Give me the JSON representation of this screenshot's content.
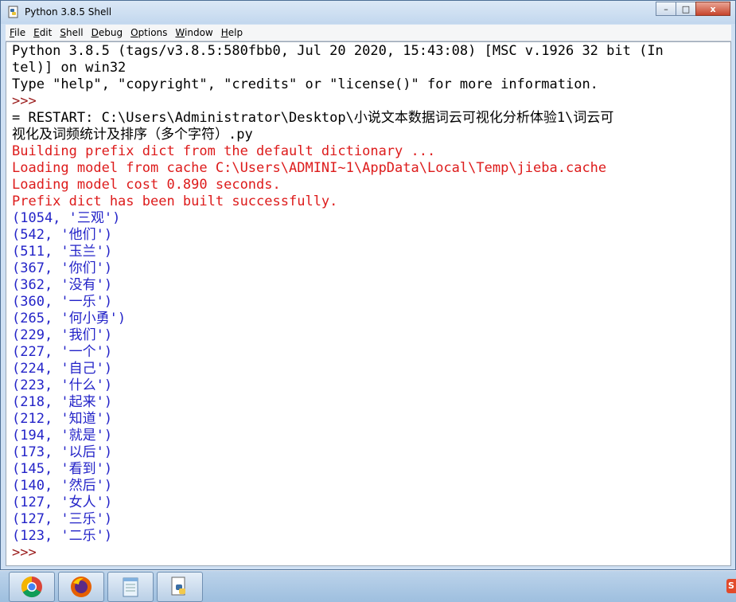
{
  "window": {
    "title": "Python 3.8.5 Shell",
    "controls": {
      "minimize": "–",
      "maximize": "□",
      "close": "x"
    }
  },
  "menubar": {
    "items": [
      {
        "label": "File",
        "accel": "F",
        "rest": "ile"
      },
      {
        "label": "Edit",
        "accel": "E",
        "rest": "dit"
      },
      {
        "label": "Shell",
        "accel": "S",
        "rest": "hell"
      },
      {
        "label": "Debug",
        "accel": "D",
        "rest": "ebug"
      },
      {
        "label": "Options",
        "accel": "O",
        "rest": "ptions"
      },
      {
        "label": "Window",
        "accel": "W",
        "rest": "indow"
      },
      {
        "label": "Help",
        "accel": "H",
        "rest": "elp"
      }
    ]
  },
  "shell": {
    "lines": [
      {
        "text": "Python 3.8.5 (tags/v3.8.5:580fbb0, Jul 20 2020, 15:43:08) [MSC v.1926 32 bit (In",
        "style": "black"
      },
      {
        "text": "tel)] on win32",
        "style": "black"
      },
      {
        "text": "Type \"help\", \"copyright\", \"credits\" or \"license()\" for more information.",
        "style": "black"
      },
      {
        "text": ">>>",
        "style": "prompt"
      },
      {
        "text": "= RESTART: C:\\Users\\Administrator\\Desktop\\小说文本数据词云可视化分析体验1\\词云可",
        "style": "black"
      },
      {
        "text": "视化及词频统计及排序（多个字符）.py",
        "style": "black"
      },
      {
        "text": "Building prefix dict from the default dictionary ...",
        "style": "red"
      },
      {
        "text": "Loading model from cache C:\\Users\\ADMINI~1\\AppData\\Local\\Temp\\jieba.cache",
        "style": "red"
      },
      {
        "text": "Loading model cost 0.890 seconds.",
        "style": "red"
      },
      {
        "text": "Prefix dict has been built successfully.",
        "style": "red"
      },
      {
        "text": "(1054, '三观')",
        "style": "blue"
      },
      {
        "text": "(542, '他们')",
        "style": "blue"
      },
      {
        "text": "(511, '玉兰')",
        "style": "blue"
      },
      {
        "text": "(367, '你们')",
        "style": "blue"
      },
      {
        "text": "(362, '没有')",
        "style": "blue"
      },
      {
        "text": "(360, '一乐')",
        "style": "blue"
      },
      {
        "text": "(265, '何小勇')",
        "style": "blue"
      },
      {
        "text": "(229, '我们')",
        "style": "blue"
      },
      {
        "text": "(227, '一个')",
        "style": "blue"
      },
      {
        "text": "(224, '自己')",
        "style": "blue"
      },
      {
        "text": "(223, '什么')",
        "style": "blue"
      },
      {
        "text": "(218, '起来')",
        "style": "blue"
      },
      {
        "text": "(212, '知道')",
        "style": "blue"
      },
      {
        "text": "(194, '就是')",
        "style": "blue"
      },
      {
        "text": "(173, '以后')",
        "style": "blue"
      },
      {
        "text": "(145, '看到')",
        "style": "blue"
      },
      {
        "text": "(140, '然后')",
        "style": "blue"
      },
      {
        "text": "(127, '女人')",
        "style": "blue"
      },
      {
        "text": "(127, '三乐')",
        "style": "blue"
      },
      {
        "text": "(123, '二乐')",
        "style": "blue"
      },
      {
        "text": ">>>",
        "style": "prompt"
      }
    ]
  },
  "taskbar": {
    "buttons": [
      {
        "name": "chrome-icon"
      },
      {
        "name": "firefox-icon"
      },
      {
        "name": "notepad-icon"
      },
      {
        "name": "python-idle-icon"
      }
    ],
    "tray_icon_text": "S"
  }
}
